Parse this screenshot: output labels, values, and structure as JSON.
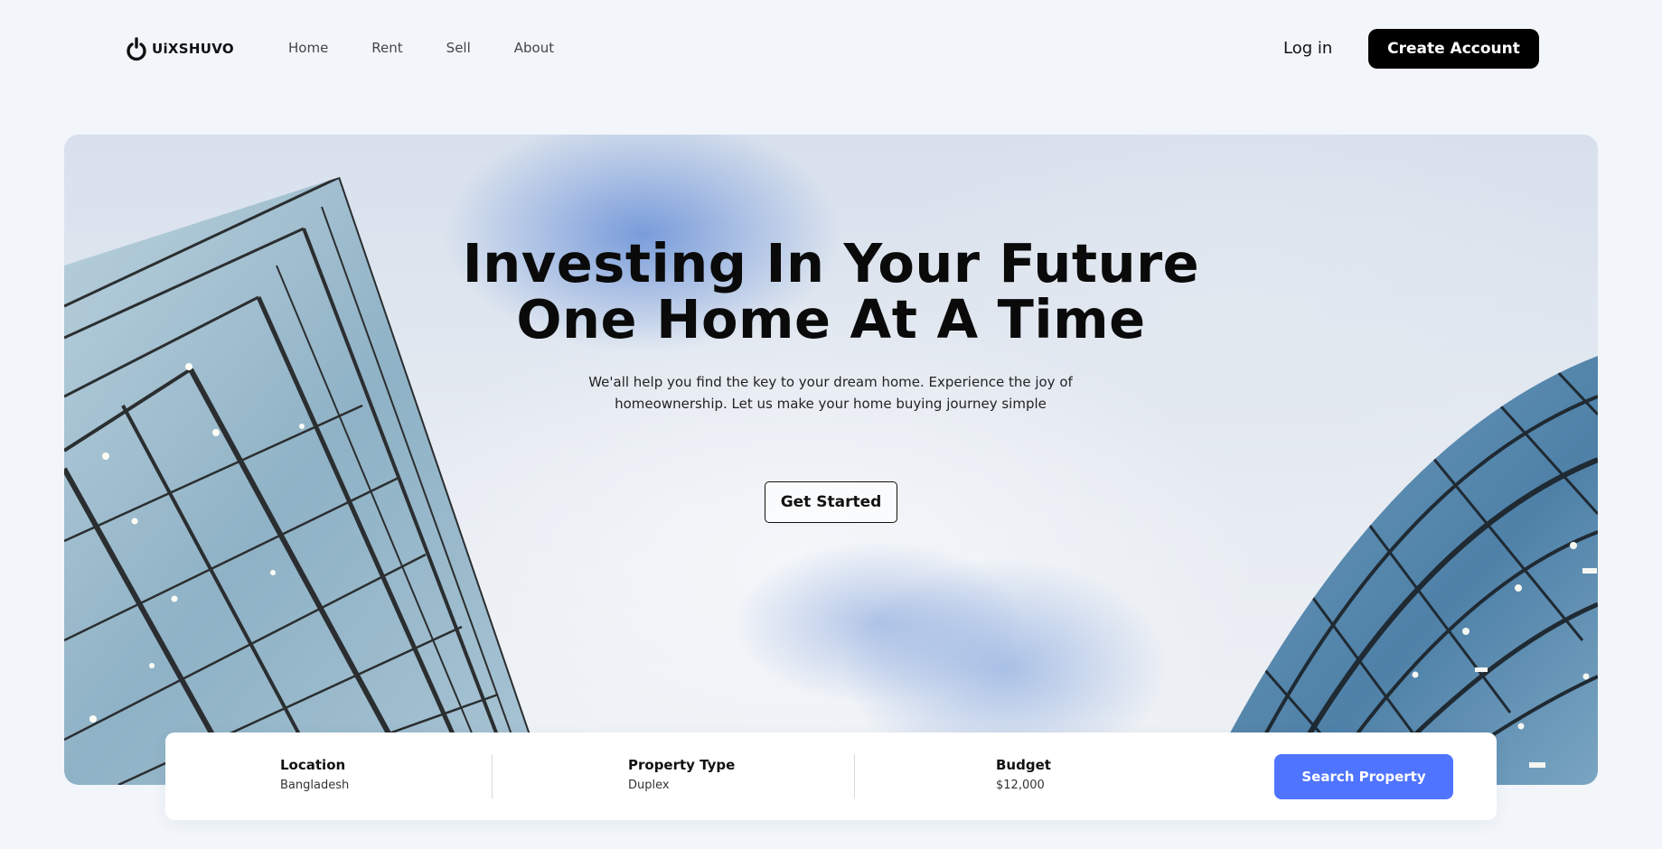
{
  "brand": {
    "name": "UiXSHUVO"
  },
  "nav": {
    "links": [
      "Home",
      "Rent",
      "Sell",
      "About"
    ],
    "login_label": "Log in",
    "create_account_label": "Create Account"
  },
  "hero": {
    "title_line1": "Investing In Your Future",
    "title_line2": "One Home At A Time",
    "subtitle": "We'all help you find the key to your dream home. Experience the joy of homeownership. Let us make your home buying journey simple",
    "cta_label": "Get Started"
  },
  "search": {
    "location": {
      "label": "Location",
      "value": "Bangladesh"
    },
    "property_type": {
      "label": "Property Type",
      "value": "Duplex"
    },
    "budget": {
      "label": "Budget",
      "value": "$12,000"
    },
    "button_label": "Search Property"
  },
  "colors": {
    "page_bg": "#f2f6fb",
    "primary_dark": "#000000",
    "accent_blue": "#4f74ff"
  }
}
